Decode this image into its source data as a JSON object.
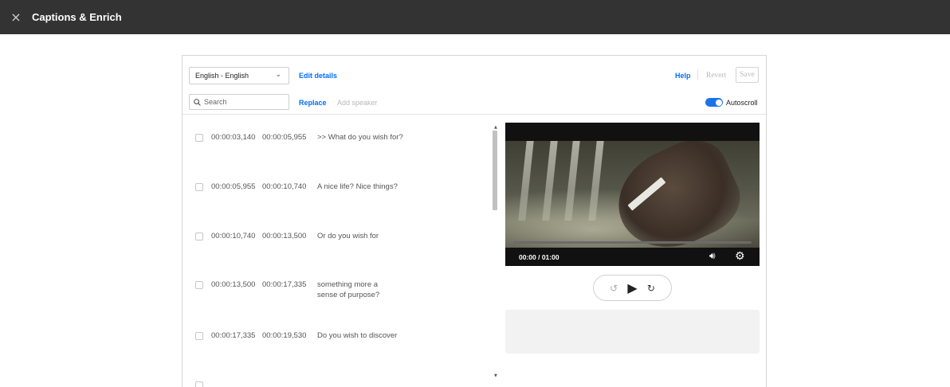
{
  "topbar": {
    "close_icon": "×",
    "title": "Captions & Enrich"
  },
  "toolbar": {
    "language": "English - English",
    "edit_details": "Edit details",
    "help": "Help",
    "revert": "Revert",
    "save": "Save"
  },
  "search": {
    "placeholder": "Search"
  },
  "actions": {
    "replace": "Replace",
    "add_speaker": "Add speaker",
    "autoscroll": "Autoscroll",
    "autoscroll_on": true
  },
  "captions": [
    {
      "start": "00:00:03,140",
      "end": "00:00:05,955",
      "text": ">> What do you wish for?"
    },
    {
      "start": "00:00:05,955",
      "end": "00:00:10,740",
      "text": "A nice life? Nice things?"
    },
    {
      "start": "00:00:10,740",
      "end": "00:00:13,500",
      "text": "Or do you wish for"
    },
    {
      "start": "00:00:13,500",
      "end": "00:00:17,335",
      "text": "something more a\nsense of purpose?"
    },
    {
      "start": "00:00:17,335",
      "end": "00:00:19,530",
      "text": "Do you wish to discover"
    }
  ],
  "player": {
    "time": "00:00 / 01:00"
  },
  "colors": {
    "topbar": "#333333",
    "link": "#006efa",
    "toggle": "#1a73e8"
  }
}
